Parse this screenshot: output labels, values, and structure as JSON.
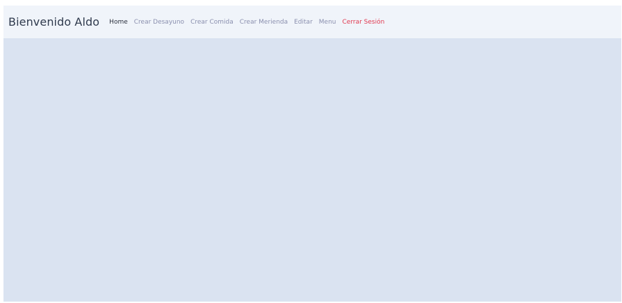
{
  "navbar": {
    "brand": "Bienvenido Aldo",
    "links": [
      {
        "label": "Home"
      },
      {
        "label": "Crear Desayuno"
      },
      {
        "label": "Crear Comida"
      },
      {
        "label": "Crear Merienda"
      },
      {
        "label": "Editar"
      },
      {
        "label": "Menu"
      },
      {
        "label": "Cerrar Sesión"
      }
    ]
  },
  "colors": {
    "navbar_bg": "#f0f4fa",
    "content_bg": "#dae3f1",
    "link": "#8a8fae",
    "active_link": "#2a2f3d",
    "logout": "#e0384f"
  }
}
